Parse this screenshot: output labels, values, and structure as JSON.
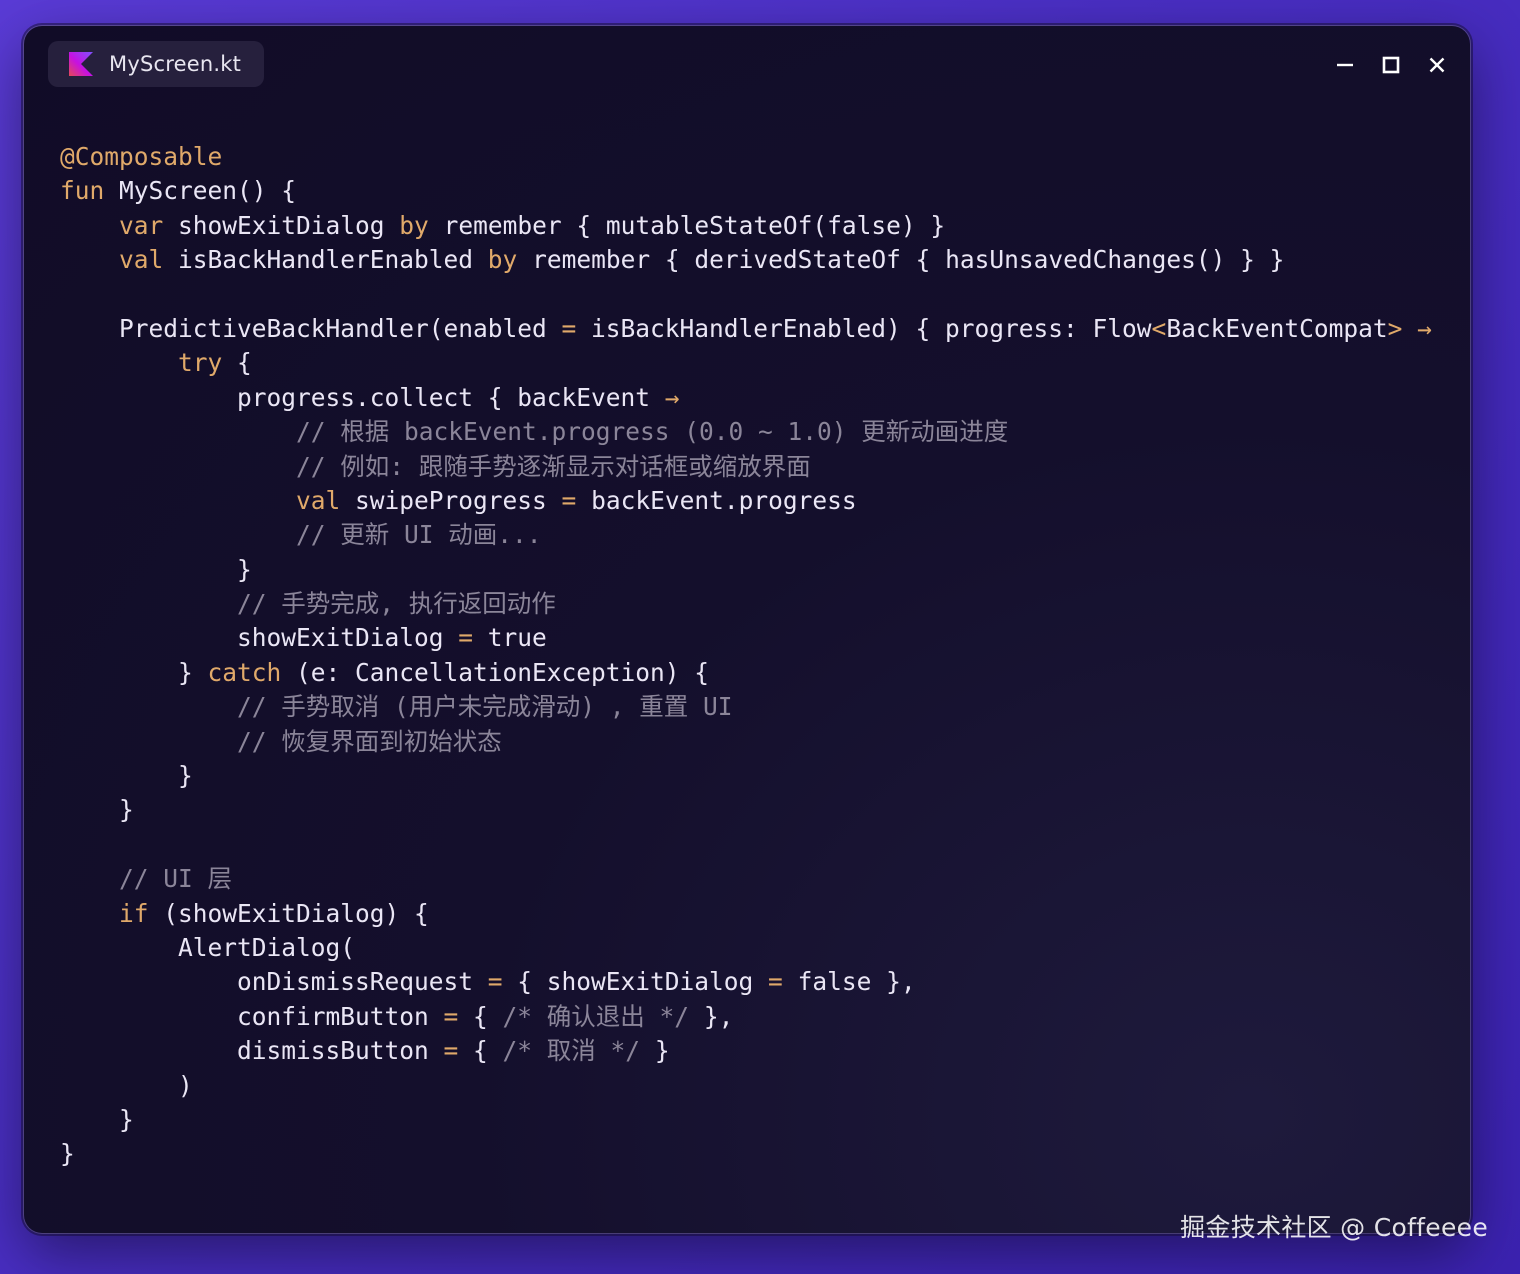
{
  "window": {
    "tab_title": "MyScreen.kt",
    "tab_icon": "kotlin-logo-icon",
    "controls": [
      "minimize-icon",
      "maximize-icon",
      "close-icon"
    ]
  },
  "colors": {
    "keyword": "#e0a96a",
    "text": "#eae6f5",
    "comment": "#8b8599",
    "background": "#110c27",
    "outer": "#4a2fc4"
  },
  "code": {
    "lines": [
      [
        {
          "t": "@Composable",
          "c": "kw"
        }
      ],
      [
        {
          "t": "fun",
          "c": "kw"
        },
        {
          "t": " MyScreen() {",
          "c": "plain"
        }
      ],
      [
        {
          "t": "    ",
          "c": "plain"
        },
        {
          "t": "var",
          "c": "kw"
        },
        {
          "t": " showExitDialog ",
          "c": "plain"
        },
        {
          "t": "by",
          "c": "kw"
        },
        {
          "t": " remember { mutableStateOf(false) }",
          "c": "plain"
        }
      ],
      [
        {
          "t": "    ",
          "c": "plain"
        },
        {
          "t": "val",
          "c": "kw"
        },
        {
          "t": " isBackHandlerEnabled ",
          "c": "plain"
        },
        {
          "t": "by",
          "c": "kw"
        },
        {
          "t": " remember { derivedStateOf { hasUnsavedChanges() } }",
          "c": "plain"
        }
      ],
      [],
      [
        {
          "t": "    PredictiveBackHandler(enabled ",
          "c": "plain"
        },
        {
          "t": "=",
          "c": "op"
        },
        {
          "t": " isBackHandlerEnabled) { progress: Flow",
          "c": "plain"
        },
        {
          "t": "<",
          "c": "op"
        },
        {
          "t": "BackEventCompat",
          "c": "plain"
        },
        {
          "t": ">",
          "c": "op"
        },
        {
          "t": " ",
          "c": "plain"
        },
        {
          "t": "→",
          "c": "op"
        }
      ],
      [
        {
          "t": "        ",
          "c": "plain"
        },
        {
          "t": "try",
          "c": "kw"
        },
        {
          "t": " {",
          "c": "plain"
        }
      ],
      [
        {
          "t": "            progress.collect { backEvent ",
          "c": "plain"
        },
        {
          "t": "→",
          "c": "op"
        }
      ],
      [
        {
          "t": "                // 根据 backEvent.progress (0.0 ~ 1.0) 更新动画进度",
          "c": "cm"
        }
      ],
      [
        {
          "t": "                // 例如: 跟随手势逐渐显示对话框或缩放界面",
          "c": "cm"
        }
      ],
      [
        {
          "t": "                ",
          "c": "plain"
        },
        {
          "t": "val",
          "c": "kw"
        },
        {
          "t": " swipeProgress ",
          "c": "plain"
        },
        {
          "t": "=",
          "c": "op"
        },
        {
          "t": " backEvent.progress",
          "c": "plain"
        }
      ],
      [
        {
          "t": "                // 更新 UI 动画...",
          "c": "cm"
        }
      ],
      [
        {
          "t": "            }",
          "c": "plain"
        }
      ],
      [
        {
          "t": "            // 手势完成, 执行返回动作",
          "c": "cm"
        }
      ],
      [
        {
          "t": "            showExitDialog ",
          "c": "plain"
        },
        {
          "t": "=",
          "c": "op"
        },
        {
          "t": " true",
          "c": "plain"
        }
      ],
      [
        {
          "t": "        } ",
          "c": "plain"
        },
        {
          "t": "catch",
          "c": "kw"
        },
        {
          "t": " (e: CancellationException) {",
          "c": "plain"
        }
      ],
      [
        {
          "t": "            // 手势取消 (用户未完成滑动) , 重置 UI",
          "c": "cm"
        }
      ],
      [
        {
          "t": "            // 恢复界面到初始状态",
          "c": "cm"
        }
      ],
      [
        {
          "t": "        }",
          "c": "plain"
        }
      ],
      [
        {
          "t": "    }",
          "c": "plain"
        }
      ],
      [],
      [
        {
          "t": "    // UI 层",
          "c": "cm"
        }
      ],
      [
        {
          "t": "    ",
          "c": "plain"
        },
        {
          "t": "if",
          "c": "kw"
        },
        {
          "t": " (showExitDialog) {",
          "c": "plain"
        }
      ],
      [
        {
          "t": "        AlertDialog(",
          "c": "plain"
        }
      ],
      [
        {
          "t": "            onDismissRequest ",
          "c": "plain"
        },
        {
          "t": "=",
          "c": "op"
        },
        {
          "t": " { showExitDialog ",
          "c": "plain"
        },
        {
          "t": "=",
          "c": "op"
        },
        {
          "t": " false },",
          "c": "plain"
        }
      ],
      [
        {
          "t": "            confirmButton ",
          "c": "plain"
        },
        {
          "t": "=",
          "c": "op"
        },
        {
          "t": " { ",
          "c": "plain"
        },
        {
          "t": "/* 确认退出 */",
          "c": "cm"
        },
        {
          "t": " },",
          "c": "plain"
        }
      ],
      [
        {
          "t": "            dismissButton ",
          "c": "plain"
        },
        {
          "t": "=",
          "c": "op"
        },
        {
          "t": " { ",
          "c": "plain"
        },
        {
          "t": "/* 取消 */",
          "c": "cm"
        },
        {
          "t": " }",
          "c": "plain"
        }
      ],
      [
        {
          "t": "        )",
          "c": "plain"
        }
      ],
      [
        {
          "t": "    }",
          "c": "plain"
        }
      ],
      [
        {
          "t": "}",
          "c": "plain"
        }
      ]
    ]
  },
  "watermark": "掘金技术社区 @ Coffeeee"
}
